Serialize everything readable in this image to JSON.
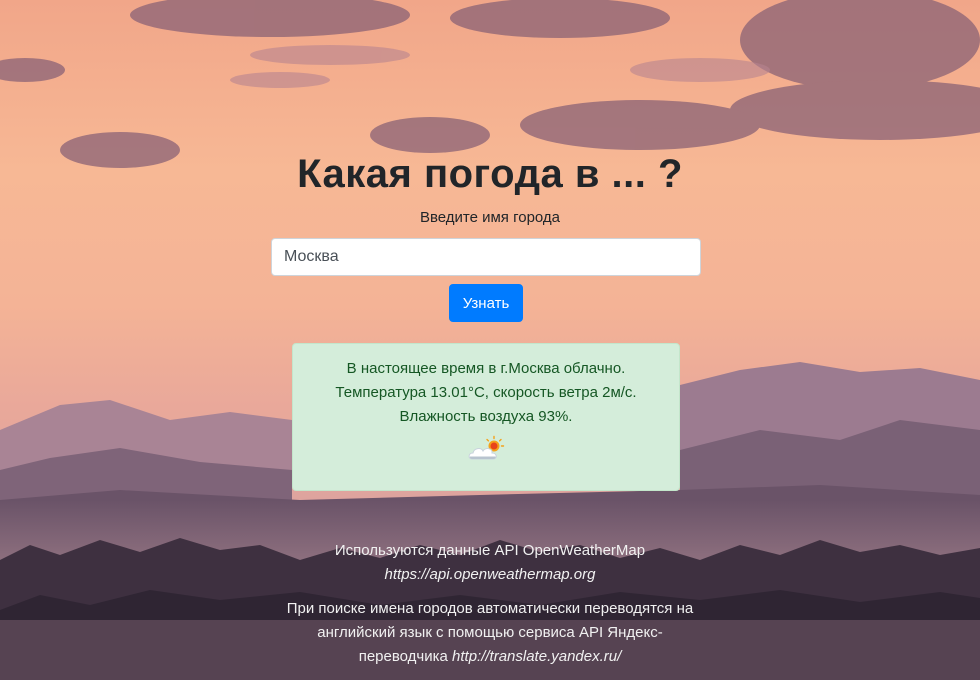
{
  "header": {
    "title": "Какая погода в ... ?"
  },
  "form": {
    "label": "Введите имя города",
    "city_value": "Москва",
    "submit_label": "Узнать"
  },
  "result": {
    "line1": "В настоящее время в г.Москва облачно.",
    "line2": "Температура 13.01°C, скорость ветра 2м/с.",
    "line3": "Влажность воздуха 93%.",
    "icon": "partly-cloudy-icon"
  },
  "footer": {
    "api_text": "Используются данные API OpenWeatherMap",
    "api_link": "https://api.openweathermap.org",
    "translate_line1": "При поиске имена городов автоматически переводятся на",
    "translate_line2": "английский язык с помощью сервиса API Яндекс-",
    "translate_line3_text": "переводчика ",
    "translate_link": "http://translate.yandex.ru/"
  },
  "colors": {
    "accent": "#007bff",
    "success_bg": "#d4edda",
    "success_text": "#155724"
  }
}
